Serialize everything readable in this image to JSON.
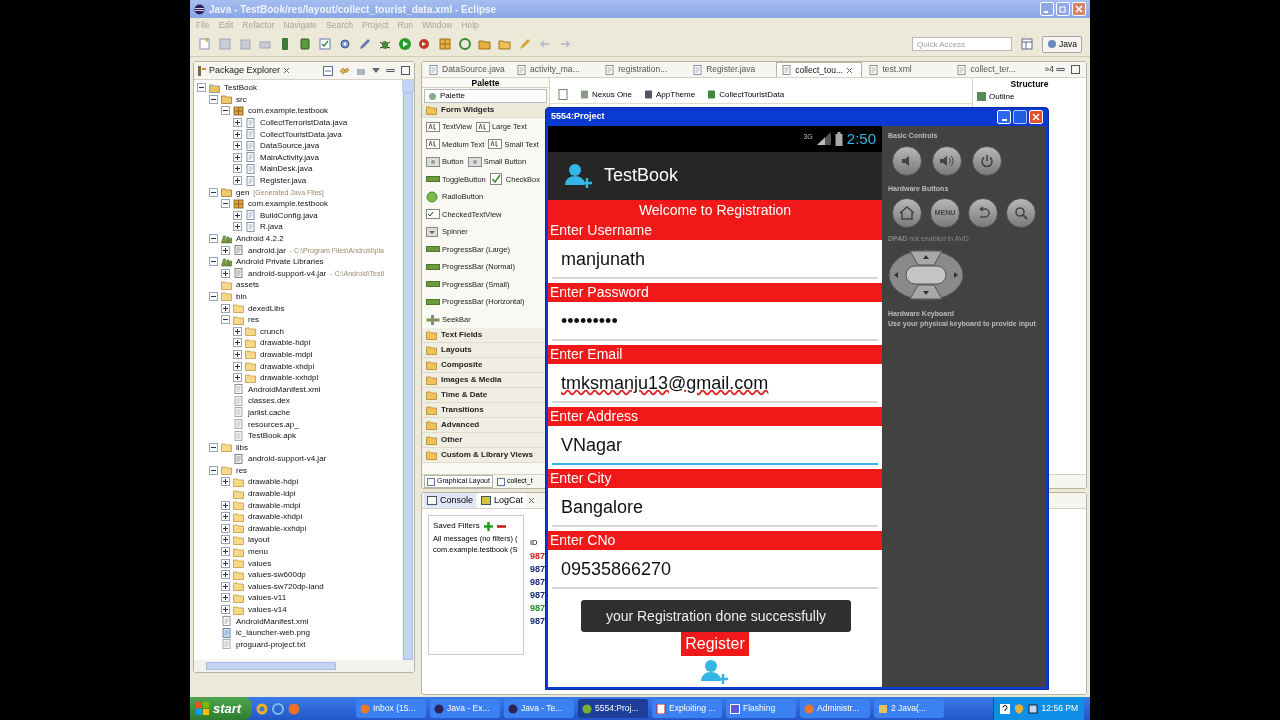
{
  "window": {
    "title": "Java - TestBook/res/layout/collect_tourist_data.xml - Eclipse"
  },
  "menu": [
    "File",
    "Edit",
    "Refactor",
    "Navigate",
    "Search",
    "Project",
    "Run",
    "Window",
    "Help"
  ],
  "toolbar": {
    "quick_access": {
      "placeholder": "Quick Access"
    },
    "perspective": "Java"
  },
  "package_explorer": {
    "title": "Package Explorer",
    "tree": [
      {
        "label": "TestBook",
        "kind": "project",
        "expanded": true,
        "children": [
          {
            "label": "src",
            "kind": "srcfolder",
            "expanded": true,
            "children": [
              {
                "label": "com.example.testbook",
                "kind": "package",
                "expanded": true,
                "children": [
                  {
                    "label": "CollectTerroristData.java",
                    "kind": "java",
                    "expanded": false
                  },
                  {
                    "label": "CollectTouristData.java",
                    "kind": "java",
                    "expanded": false
                  },
                  {
                    "label": "DataSource.java",
                    "kind": "java",
                    "expanded": false
                  },
                  {
                    "label": "MainActivity.java",
                    "kind": "java",
                    "expanded": false
                  },
                  {
                    "label": "MainDesk.java",
                    "kind": "java",
                    "expanded": false
                  },
                  {
                    "label": "Register.java",
                    "kind": "java",
                    "expanded": false
                  }
                ]
              }
            ]
          },
          {
            "label": "gen",
            "suffix": "[Generated Java Files]",
            "kind": "srcfolder",
            "expanded": true,
            "children": [
              {
                "label": "com.example.testbook",
                "kind": "package",
                "expanded": true,
                "children": [
                  {
                    "label": "BuildConfig.java",
                    "kind": "java",
                    "expanded": false
                  },
                  {
                    "label": "R.java",
                    "kind": "java",
                    "expanded": false
                  }
                ]
              }
            ]
          },
          {
            "label": "Android 4.2.2",
            "kind": "library",
            "expanded": true,
            "children": [
              {
                "label": "android.jar",
                "suffix": "- C:\\Program Files\\Android\\pla",
                "kind": "jar",
                "expanded": false
              }
            ]
          },
          {
            "label": "Android Private Libraries",
            "kind": "library",
            "expanded": true,
            "children": [
              {
                "label": "android-support-v4.jar",
                "suffix": "- C:\\Android\\Testl",
                "kind": "jar",
                "expanded": false
              }
            ]
          },
          {
            "label": "assets",
            "kind": "folder"
          },
          {
            "label": "bin",
            "kind": "folder",
            "expanded": true,
            "children": [
              {
                "label": "dexedLibs",
                "kind": "folder",
                "expanded": false
              },
              {
                "label": "res",
                "kind": "folder",
                "expanded": true,
                "children": [
                  {
                    "label": "crunch",
                    "kind": "folder",
                    "expanded": false
                  },
                  {
                    "label": "drawable-hdpi",
                    "kind": "folder",
                    "expanded": false
                  },
                  {
                    "label": "drawable-mdpi",
                    "kind": "folder",
                    "expanded": false
                  },
                  {
                    "label": "drawable-xhdpi",
                    "kind": "folder",
                    "expanded": false
                  },
                  {
                    "label": "drawable-xxhdpi",
                    "kind": "folder",
                    "expanded": false
                  }
                ]
              },
              {
                "label": "AndroidManifest.xml",
                "kind": "xml"
              },
              {
                "label": "classes.dex",
                "kind": "file"
              },
              {
                "label": "jarlist.cache",
                "kind": "file"
              },
              {
                "label": "resources.ap_",
                "kind": "file"
              },
              {
                "label": "TestBook.apk",
                "kind": "file"
              }
            ]
          },
          {
            "label": "libs",
            "kind": "folder",
            "expanded": true,
            "children": [
              {
                "label": "android-support-v4.jar",
                "kind": "jar"
              }
            ]
          },
          {
            "label": "res",
            "kind": "folder",
            "expanded": true,
            "children": [
              {
                "label": "drawable-hdpi",
                "kind": "folder",
                "expanded": false
              },
              {
                "label": "drawable-ldpi",
                "kind": "folder"
              },
              {
                "label": "drawable-mdpi",
                "kind": "folder",
                "expanded": false
              },
              {
                "label": "drawable-xhdpi",
                "kind": "folder",
                "expanded": false
              },
              {
                "label": "drawable-xxhdpi",
                "kind": "folder",
                "expanded": false
              },
              {
                "label": "layout",
                "kind": "folder",
                "expanded": false
              },
              {
                "label": "menu",
                "kind": "folder",
                "expanded": false
              },
              {
                "label": "values",
                "kind": "folder",
                "expanded": false
              },
              {
                "label": "values-sw600dp",
                "kind": "folder",
                "expanded": false
              },
              {
                "label": "values-sw720dp-land",
                "kind": "folder",
                "expanded": false
              },
              {
                "label": "values-v11",
                "kind": "folder",
                "expanded": false
              },
              {
                "label": "values-v14",
                "kind": "folder",
                "expanded": false
              }
            ]
          },
          {
            "label": "AndroidManifest.xml",
            "kind": "xml"
          },
          {
            "label": "ic_launcher-web.png",
            "kind": "image"
          },
          {
            "label": "proguard-project.txt",
            "kind": "file"
          }
        ]
      }
    ]
  },
  "editor": {
    "tabs": [
      {
        "label": "DataSource.java",
        "kind": "java",
        "selected": false
      },
      {
        "label": "activity_ma...",
        "kind": "xml",
        "selected": false
      },
      {
        "label": "registration...",
        "kind": "xml",
        "selected": false
      },
      {
        "label": "Register.java",
        "kind": "java",
        "selected": false
      },
      {
        "label": "collect_tou...",
        "kind": "xml",
        "selected": true
      },
      {
        "label": "test.xml",
        "kind": "xml",
        "selected": false
      },
      {
        "label": "collect_ter...",
        "kind": "xml",
        "selected": false
      }
    ],
    "overflow": "»4",
    "palette": {
      "title": "Palette",
      "dropdown": "Palette",
      "groups": [
        {
          "label": "Form Widgets",
          "expanded": true,
          "rows": [
            [
              {
                "label": "TextView",
                "kind": "text"
              },
              {
                "label": "Large Text",
                "kind": "text"
              }
            ],
            [
              {
                "label": "Medium Text",
                "kind": "text"
              },
              {
                "label": "Small Text",
                "kind": "text"
              }
            ],
            [
              {
                "label": "Button",
                "kind": "button"
              },
              {
                "label": "Small Button",
                "kind": "button"
              }
            ],
            [
              {
                "label": "ToggleButton",
                "kind": "toggle"
              },
              {
                "label": "CheckBox",
                "kind": "checkbox"
              }
            ],
            [
              {
                "label": "RadioButton",
                "kind": "radio"
              }
            ],
            [
              {
                "label": "CheckedTextView",
                "kind": "checked"
              }
            ],
            [
              {
                "label": "Spinner",
                "kind": "spinner"
              }
            ],
            [
              {
                "label": "ProgressBar (Large)",
                "kind": "progress"
              }
            ],
            [
              {
                "label": "ProgressBar (Normal)",
                "kind": "progress"
              }
            ],
            [
              {
                "label": "ProgressBar (Small)",
                "kind": "progress"
              }
            ],
            [
              {
                "label": "ProgressBar (Horizontal)",
                "kind": "progress"
              }
            ],
            [
              {
                "label": "SeekBar",
                "kind": "seekbar"
              }
            ]
          ]
        },
        {
          "label": "Text Fields",
          "expanded": false
        },
        {
          "label": "Layouts",
          "expanded": false
        },
        {
          "label": "Composite",
          "expanded": false
        },
        {
          "label": "Images & Media",
          "expanded": false
        },
        {
          "label": "Time & Date",
          "expanded": false
        },
        {
          "label": "Transitions",
          "expanded": false
        },
        {
          "label": "Advanced",
          "expanded": false
        },
        {
          "label": "Other",
          "expanded": false
        },
        {
          "label": "Custom & Library Views",
          "expanded": false
        }
      ]
    },
    "layout_toolbar": [
      "Nexus One",
      "AppTheme",
      "CollectTouristData"
    ],
    "structure": {
      "title": "Structure",
      "outline": "Outline"
    },
    "bottom_tabs": [
      {
        "label": "Graphical Layout",
        "selected": true
      },
      {
        "label": "collect_t",
        "selected": false
      }
    ]
  },
  "console": {
    "tabs": [
      {
        "label": "Console",
        "selected": false
      },
      {
        "label": "LogCat",
        "selected": true
      }
    ],
    "saved_filters": "Saved Filters",
    "filters": [
      "All messages (no filters) (",
      "com.example.testbook (S"
    ],
    "id_header": "ID",
    "log_ids": [
      {
        "text": "987",
        "color": "#d02020"
      },
      {
        "text": "987",
        "color": "#1a2a80"
      },
      {
        "text": "987",
        "color": "#1a2a80"
      },
      {
        "text": "987",
        "color": "#1a2a80"
      },
      {
        "text": "987",
        "color": "#2a8a2a"
      },
      {
        "text": "987",
        "color": "#1a2a80"
      }
    ]
  },
  "emulator": {
    "title": "5554:Project",
    "status_bar": {
      "network": "3G",
      "time": "2:50"
    },
    "app_title": "TestBook",
    "banner": "Welcome to Registration",
    "fields": [
      {
        "label": "Enter Username",
        "value": "manjunath",
        "focused": false,
        "misspelled": false
      },
      {
        "label": "Enter Password",
        "value": "•••••••••",
        "focused": false,
        "misspelled": false
      },
      {
        "label": "Enter Email",
        "value": "tmksmanju13@gmail.com",
        "focused": false,
        "misspelled": true
      },
      {
        "label": "Enter Address",
        "value": "VNagar",
        "focused": true,
        "misspelled": false
      },
      {
        "label": "Enter City",
        "value": "Bangalore",
        "focused": false,
        "misspelled": false
      },
      {
        "label": "Enter CNo",
        "value": "09535866270",
        "focused": false,
        "misspelled": false
      }
    ],
    "button": "Register",
    "toast": "your Registration done successfully",
    "controls": {
      "basic_title": "Basic Controls",
      "hardware_title": "Hardware Buttons",
      "menu_key": "MENU",
      "dpad_note": "**DPAD** not enabled in AVD",
      "keyboard_title": "Hardware Keyboard",
      "keyboard_note": "Use your physical keyboard to provide input"
    }
  },
  "taskbar": {
    "start": "start",
    "items": [
      {
        "label": "Inbox (15...",
        "kind": "browser",
        "selected": false
      },
      {
        "label": "Java - Ex...",
        "kind": "eclipse",
        "selected": false
      },
      {
        "label": "Java - Te...",
        "kind": "eclipse",
        "selected": false
      },
      {
        "label": "5554:Proj...",
        "kind": "emulator",
        "selected": true
      },
      {
        "label": "Exploiting ...",
        "kind": "document",
        "selected": false
      },
      {
        "label": "Flashing",
        "kind": "window",
        "selected": false
      },
      {
        "label": "Administr...",
        "kind": "browser",
        "selected": false
      },
      {
        "label": "2 Java(...",
        "kind": "group",
        "selected": false
      }
    ],
    "clock": "12:56 PM"
  }
}
